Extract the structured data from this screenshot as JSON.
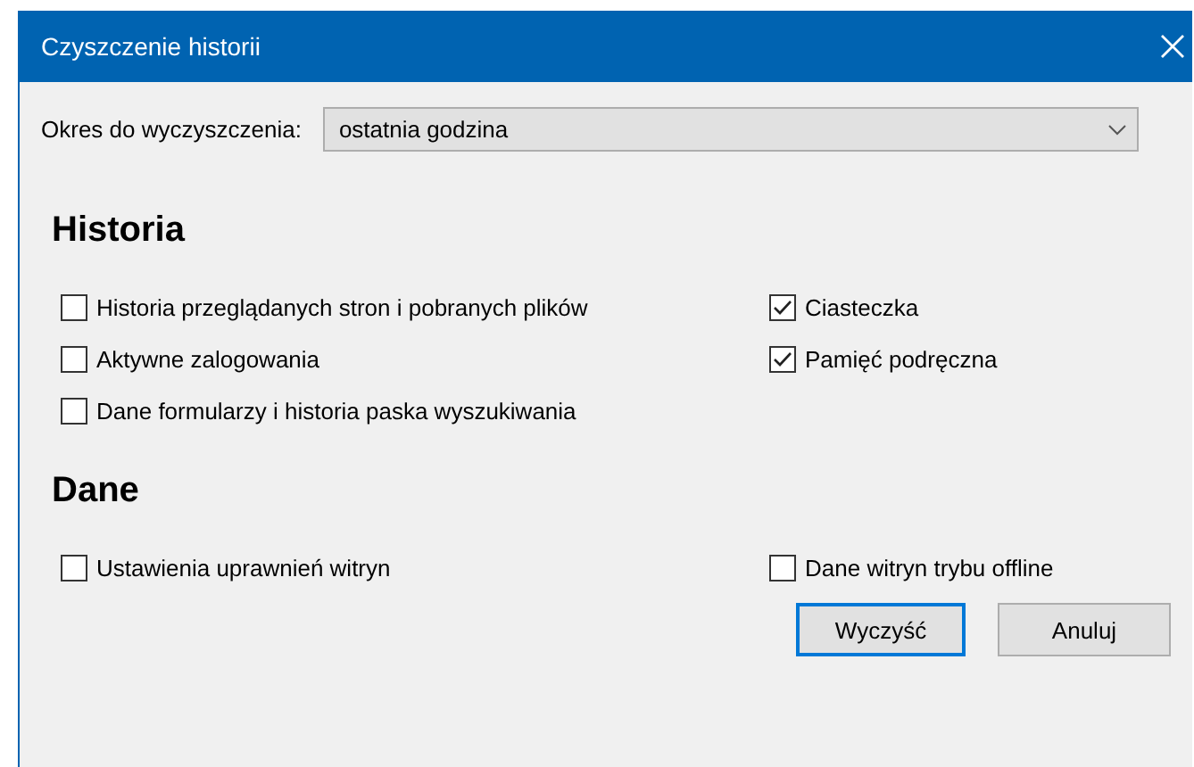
{
  "window": {
    "title": "Czyszczenie historii"
  },
  "period": {
    "label": "Okres do wyczyszczenia:",
    "value": "ostatnia godzina"
  },
  "sections": [
    {
      "title": "Historia",
      "left_items": [
        {
          "label": "Historia przeglądanych stron i pobranych plików",
          "checked": false
        },
        {
          "label": "Aktywne zalogowania",
          "checked": false
        },
        {
          "label": "Dane formularzy i historia paska wyszukiwania",
          "checked": false
        }
      ],
      "right_items": [
        {
          "label": "Ciasteczka",
          "checked": true
        },
        {
          "label": "Pamięć podręczna",
          "checked": true
        }
      ]
    },
    {
      "title": "Dane",
      "left_items": [
        {
          "label": "Ustawienia uprawnień witryn",
          "checked": false
        }
      ],
      "right_items": [
        {
          "label": "Dane witryn trybu offline",
          "checked": false
        }
      ]
    }
  ],
  "buttons": [
    {
      "label": "Wyczyść",
      "selected": true
    },
    {
      "label": "Anuluj",
      "selected": false
    }
  ]
}
